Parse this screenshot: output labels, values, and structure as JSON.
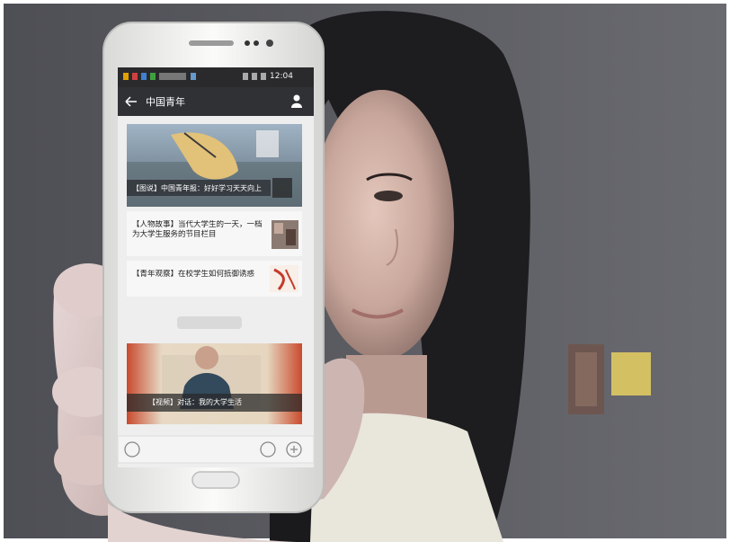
{
  "status_bar": {
    "time": "12:04",
    "icons": [
      "signal-icon",
      "wifi-icon",
      "battery-icon"
    ]
  },
  "app_header": {
    "title": "中国青年",
    "back_icon": "arrow-left-icon",
    "profile_icon": "person-icon"
  },
  "feed": {
    "top_banner_caption": "【图说】中国青年报：好好学习天天向上",
    "items": [
      {
        "text": "【人物故事】当代大学生的一天，一档为大学生服务的节目栏目",
        "thumbnail": "news-thumbnail"
      },
      {
        "text": "【青年观察】在校学生如何抵御诱惑",
        "thumbnail": "calligraphy-thumbnail"
      }
    ],
    "video_caption": "【视频】对话：我的大学生活"
  },
  "bottom_bar": {
    "icons": [
      "voice-icon",
      "emoji-icon",
      "plus-icon"
    ]
  },
  "colors": {
    "background_wall": "#5e5f64",
    "phone_body": "#f2f2f0",
    "app_header": "#2f3135",
    "status_bar": "#2a2a2d",
    "screen_bg": "#eeeeee"
  }
}
